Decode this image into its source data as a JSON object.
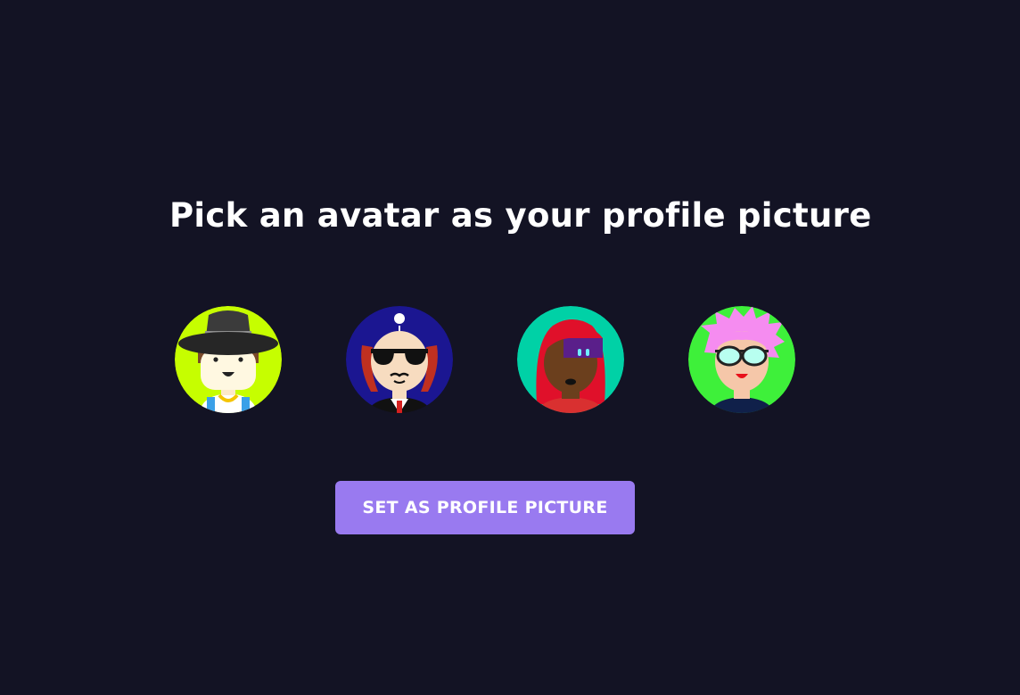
{
  "header": {
    "title": "Pick an avatar as your profile picture"
  },
  "avatars": [
    {
      "name": "avatar-hat-man",
      "background": "#c6fe00"
    },
    {
      "name": "avatar-sunglasses-man",
      "background": "#1b1691"
    },
    {
      "name": "avatar-red-hair-woman",
      "background": "#00d1a6"
    },
    {
      "name": "avatar-pink-hair-person",
      "background": "#3ef03a"
    }
  ],
  "actions": {
    "submit_label": "SET AS PROFILE PICTURE"
  },
  "colors": {
    "page_background": "#131324",
    "accent": "#997af0",
    "text": "#ffffff"
  }
}
